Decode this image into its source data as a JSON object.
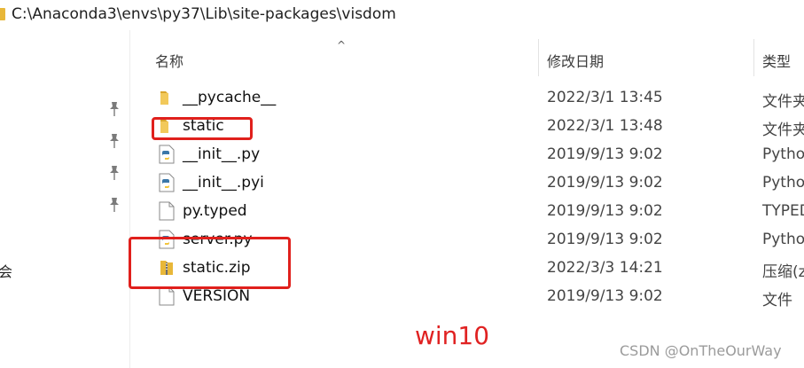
{
  "address_bar": {
    "path": "C:\\Anaconda3\\envs\\py37\\Lib\\site-packages\\visdom"
  },
  "nav": {
    "partial_label": "会"
  },
  "header": {
    "sort_indicator": "^",
    "col_name": "名称",
    "col_date": "修改日期",
    "col_type": "类型"
  },
  "files": [
    {
      "name": "__pycache__",
      "date": "2022/3/1 13:45",
      "type": "文件夹",
      "icon": "folder-icon"
    },
    {
      "name": "static",
      "date": "2022/3/1 13:48",
      "type": "文件夹",
      "icon": "folder-icon"
    },
    {
      "name": "__init__.py",
      "date": "2019/9/13 9:02",
      "type": "Python",
      "icon": "python-file-icon"
    },
    {
      "name": "__init__.pyi",
      "date": "2019/9/13 9:02",
      "type": "Python",
      "icon": "python-file-icon"
    },
    {
      "name": "py.typed",
      "date": "2019/9/13 9:02",
      "type": "TYPED",
      "icon": "blank-file-icon"
    },
    {
      "name": "server.py",
      "date": "2019/9/13 9:02",
      "type": "Python",
      "icon": "python-file-icon"
    },
    {
      "name": "static.zip",
      "date": "2022/3/3 14:21",
      "type": "压缩(z",
      "icon": "zip-folder-icon"
    },
    {
      "name": "VERSION",
      "date": "2019/9/13 9:02",
      "type": "文件",
      "icon": "blank-file-icon"
    }
  ],
  "annotation": {
    "text": "win10",
    "color": "#e02222"
  },
  "watermark": {
    "text": "CSDN @OnTheOurWay"
  },
  "colors": {
    "highlight": "#e0201c",
    "folder": "#e8b739",
    "python_blue": "#3b77a8",
    "python_yellow": "#f2c53d"
  }
}
